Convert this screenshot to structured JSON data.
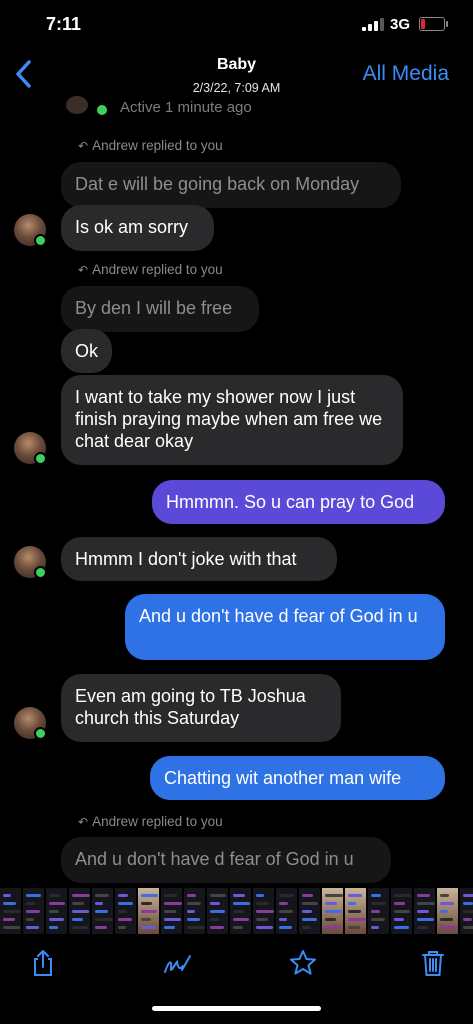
{
  "status_bar": {
    "time": "7:11",
    "network": "3G",
    "battery_color": "#e0243b"
  },
  "nav": {
    "back_icon": "chevron-left-icon",
    "title": "Baby",
    "subtitle": "2/3/22, 7:09 AM",
    "all_media": "All Media",
    "accent": "#3b8df5"
  },
  "chat": {
    "active_status": "Active 1 minute ago",
    "reply_note_1": "Andrew replied to you",
    "quoted_1": "Dat e will be going back on Monday",
    "msg_1": "Is ok am sorry",
    "reply_note_2": "Andrew replied to you",
    "quoted_2": "By den I will be free",
    "msg_2": "Ok",
    "msg_3": "I want to take my shower now I just finish praying maybe when am free we chat dear okay",
    "sent_1": "Hmmmn. So u can pray to God",
    "msg_4": "Hmmm I don't joke with that",
    "sent_2": "And u don't have d fear of God in u",
    "msg_5": "Even am going to TB Joshua church this Saturday",
    "sent_3": "Chatting wit another man wife",
    "reply_note_3": "Andrew replied to you",
    "quoted_3": "And u don't have d fear of God in u",
    "bubble_colors": {
      "incoming": "#2a2a2c",
      "sent_purple": "#5b4ad8",
      "sent_blue": "#2f72e6"
    }
  },
  "toolbar": {
    "share_icon": "share-icon",
    "markup_icon": "markup-icon",
    "favorite_icon": "star-icon",
    "delete_icon": "trash-icon"
  }
}
